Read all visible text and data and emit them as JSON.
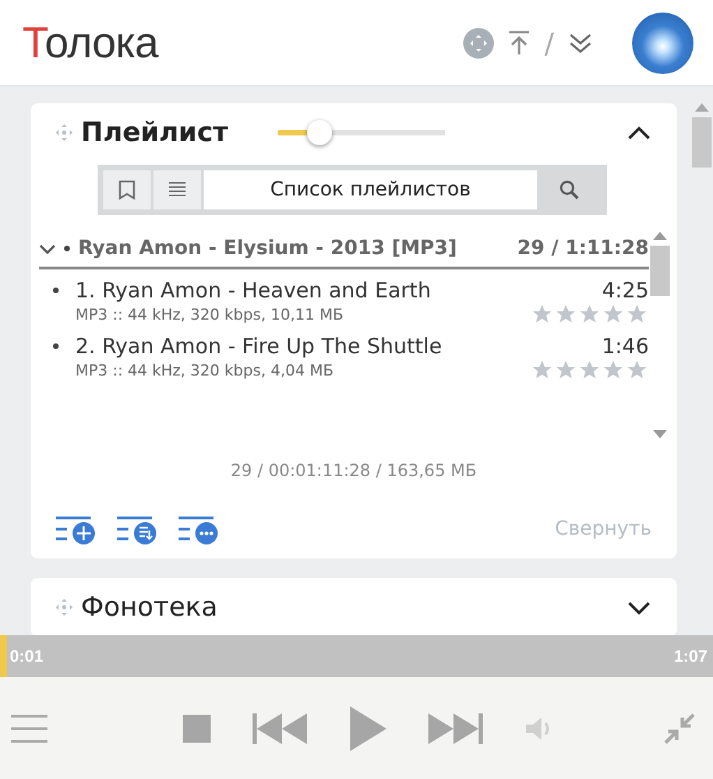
{
  "header": {
    "logo": "Толока",
    "separator": "/"
  },
  "playlist": {
    "title": "Плейлист",
    "expanded": true,
    "slider": {
      "level": 0.25
    },
    "search": {
      "value": "Список плейлистов"
    },
    "album": {
      "title": "Ryan Amon - Elysium - 2013 [MP3]",
      "summary": "29 / 1:11:28",
      "expanded": true
    },
    "tracks": [
      {
        "title": "1. Ryan Amon - Heaven and Earth",
        "duration": "4:25",
        "info": "MP3 :: 44 kHz, 320 kbps, 10,11 МБ",
        "stars": 0
      },
      {
        "title": "2. Ryan Amon - Fire Up The Shuttle",
        "duration": "1:46",
        "info": "MP3 :: 44 kHz, 320 kbps, 4,04 МБ",
        "stars": 0
      }
    ],
    "totals": "29 / 00:01:11:28 / 163,65 МБ",
    "collapse": "Свернуть"
  },
  "library": {
    "title": "Фонотека",
    "expanded": false
  },
  "player": {
    "elapsed": "0:01",
    "total": "1:07",
    "progress": {
      "level": 0.01
    }
  }
}
